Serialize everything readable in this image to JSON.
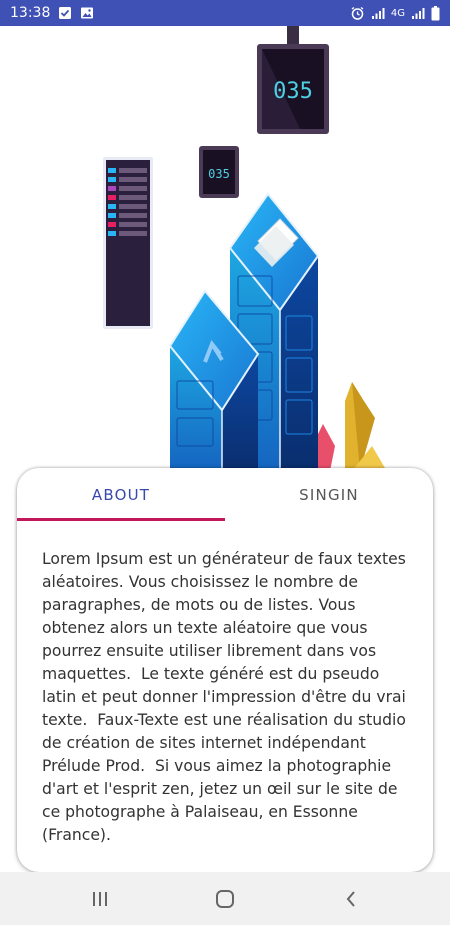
{
  "status_bar": {
    "time": "13:38",
    "network_label": "4G",
    "icons": [
      "checkbox-notification-icon",
      "image-notification-icon",
      "alarm-icon",
      "signal-icon",
      "signal-4g-icon",
      "battery-icon"
    ]
  },
  "tabs": [
    {
      "label": "ABOUT",
      "active": true
    },
    {
      "label": "SINGIN",
      "active": false
    }
  ],
  "screens": {
    "small": "035",
    "large": "035"
  },
  "about_text": "Lorem Ipsum est un générateur de faux textes aléatoires. Vous choisissez le nombre de paragraphes, de mots ou de listes. Vous obtenez alors un texte aléatoire que vous pourrez ensuite utiliser librement dans vos maquettes.  Le texte généré est du pseudo latin et peut donner l'impression d'être du vrai texte.  Faux-Texte est une réalisation du studio de création de sites internet indépendant Prélude Prod.  Si vous aimez la photographie d'art et l'esprit zen, jetez un œil sur le site de ce photographe à Palaiseau, en Essonne (France).",
  "colors": {
    "status_bar": "#3f51b5",
    "tab_active_text": "#3949ab",
    "tab_indicator": "#c2185b",
    "nav_bar": "#f1f1f1"
  },
  "nav_bar": {
    "icons": [
      "recent-apps-icon",
      "home-icon",
      "back-icon"
    ]
  }
}
